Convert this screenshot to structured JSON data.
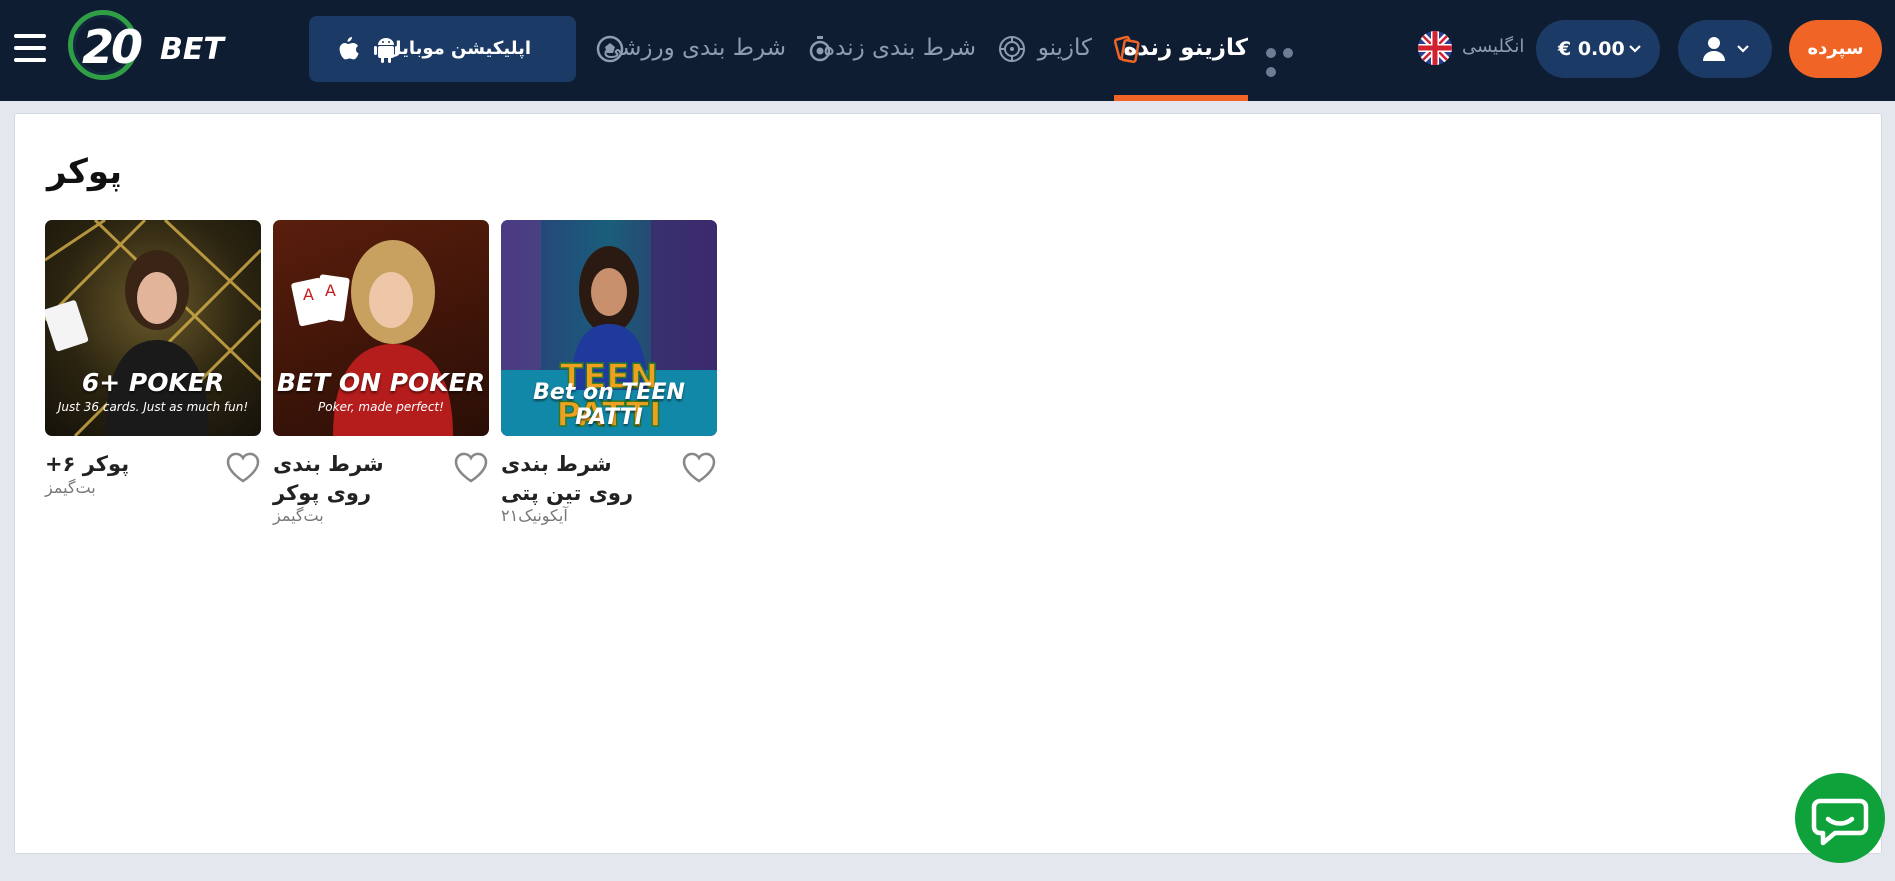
{
  "header": {
    "logo_number": "20",
    "logo_text": "BET",
    "app_button_label": "اپلیکیشن موبایل",
    "nav": [
      {
        "label": "شرط بندی ورزشی"
      },
      {
        "label": "شرط بندی زنده"
      },
      {
        "label": "کازینو"
      },
      {
        "label": "کازینو زنده"
      }
    ],
    "language": "انگلیسی",
    "balance": "€  0.00",
    "deposit_label": "سپرده"
  },
  "page": {
    "title": "پوکر"
  },
  "games": [
    {
      "name": "+پوکر ۶",
      "provider": "بت‌گیمز",
      "image_title": "6+ POKER",
      "image_subtitle": "Just 36 cards. Just as much fun!"
    },
    {
      "name": "شرط بندی روی پوکر",
      "provider": "بت‌گیمز",
      "image_title": "BET ON POKER",
      "image_subtitle": "Poker, made perfect!"
    },
    {
      "name": "شرط بندی روی تین پتی",
      "provider": "آیکونیک۲۱",
      "image_title": "Bet on TEEN PATTI",
      "image_subtitle": ""
    }
  ],
  "colors": {
    "header_bg": "#0f1d33",
    "button_bg": "#1c3a66",
    "accent": "#f06425",
    "chat": "#10a23a"
  },
  "icons": [
    "menu-icon",
    "apple-icon",
    "android-icon",
    "soccer-ball-icon",
    "stopwatch-icon",
    "roulette-icon",
    "cards-icon",
    "more-icon",
    "uk-flag-icon",
    "chevron-down-icon",
    "user-icon",
    "heart-icon",
    "chat-icon"
  ]
}
